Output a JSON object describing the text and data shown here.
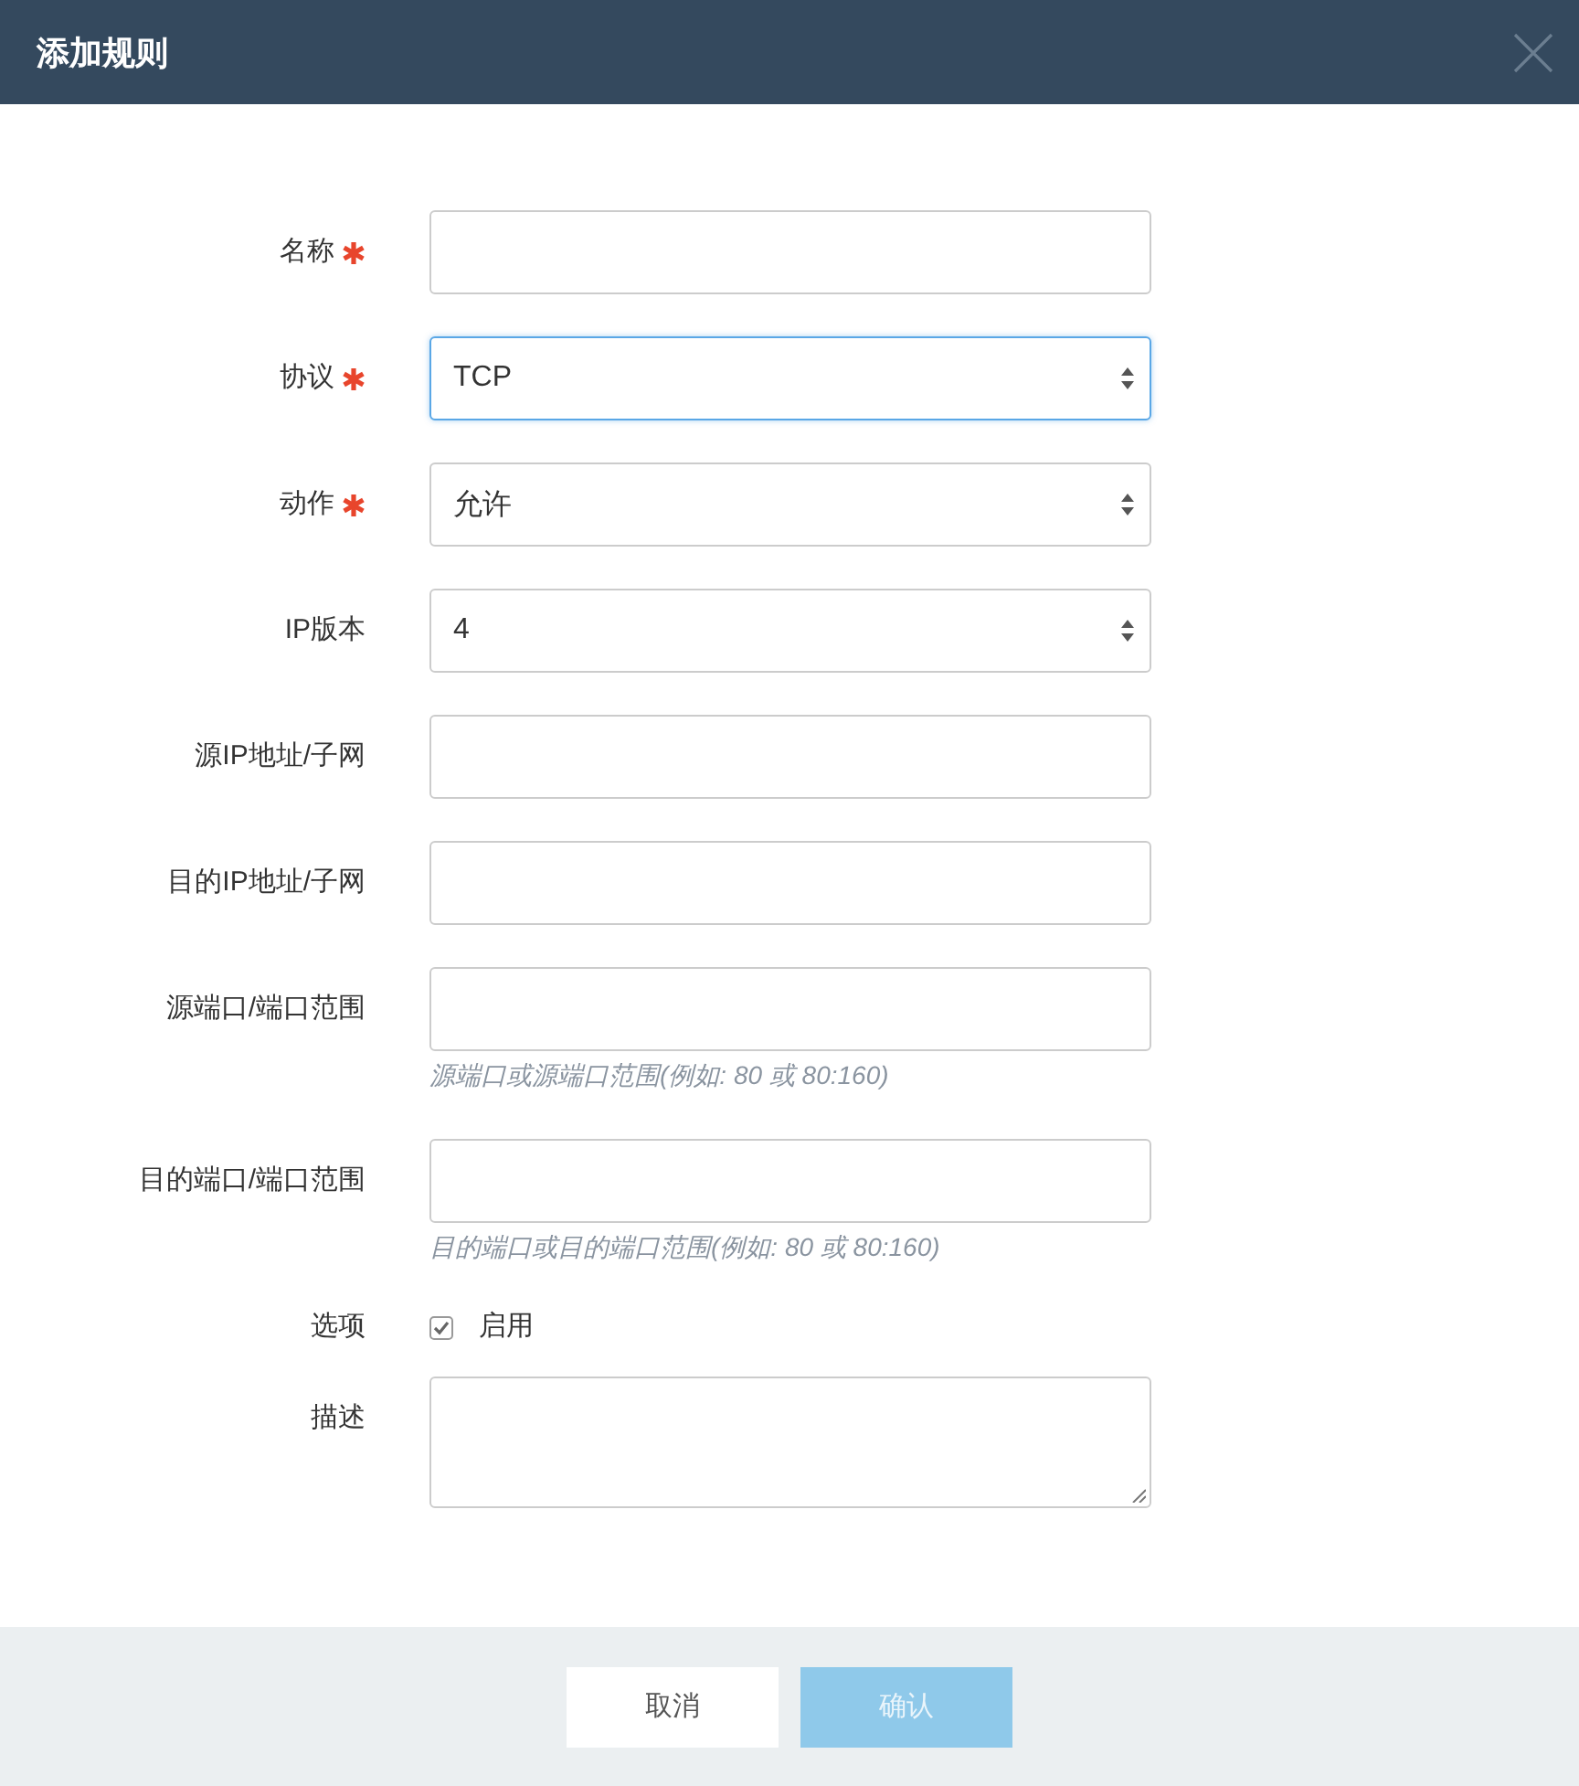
{
  "dialog": {
    "title": "添加规则"
  },
  "fields": [
    {
      "kind": "text",
      "label": "名称",
      "required": true,
      "focused": false
    },
    {
      "kind": "select",
      "label": "协议",
      "required": true,
      "value": "TCP",
      "focused": true
    },
    {
      "kind": "select",
      "label": "动作",
      "required": true,
      "value": "允许",
      "focused": false
    },
    {
      "kind": "select",
      "label": "IP版本",
      "required": false,
      "value": "4",
      "focused": false
    },
    {
      "kind": "text",
      "label": "源IP地址/子网",
      "required": false,
      "focused": false
    },
    {
      "kind": "text",
      "label": "目的IP地址/子网",
      "required": false,
      "focused": false
    },
    {
      "kind": "text",
      "label": "源端口/端口范围",
      "required": false,
      "focused": false,
      "hint": "源端口或源端口范围(例如: 80 或 80:160)"
    },
    {
      "kind": "text",
      "label": "目的端口/端口范围",
      "required": false,
      "focused": false,
      "hint": "目的端口或目的端口范围(例如: 80 或 80:160)"
    },
    {
      "kind": "checkbox",
      "label": "选项",
      "required": false,
      "option": "启用",
      "checked": true
    },
    {
      "kind": "textarea",
      "label": "描述",
      "required": false,
      "focused": false
    }
  ],
  "buttons": [
    {
      "label": "取消",
      "kind": "secondary",
      "disabled": false
    },
    {
      "label": "确认",
      "kind": "primary",
      "disabled": true
    }
  ]
}
